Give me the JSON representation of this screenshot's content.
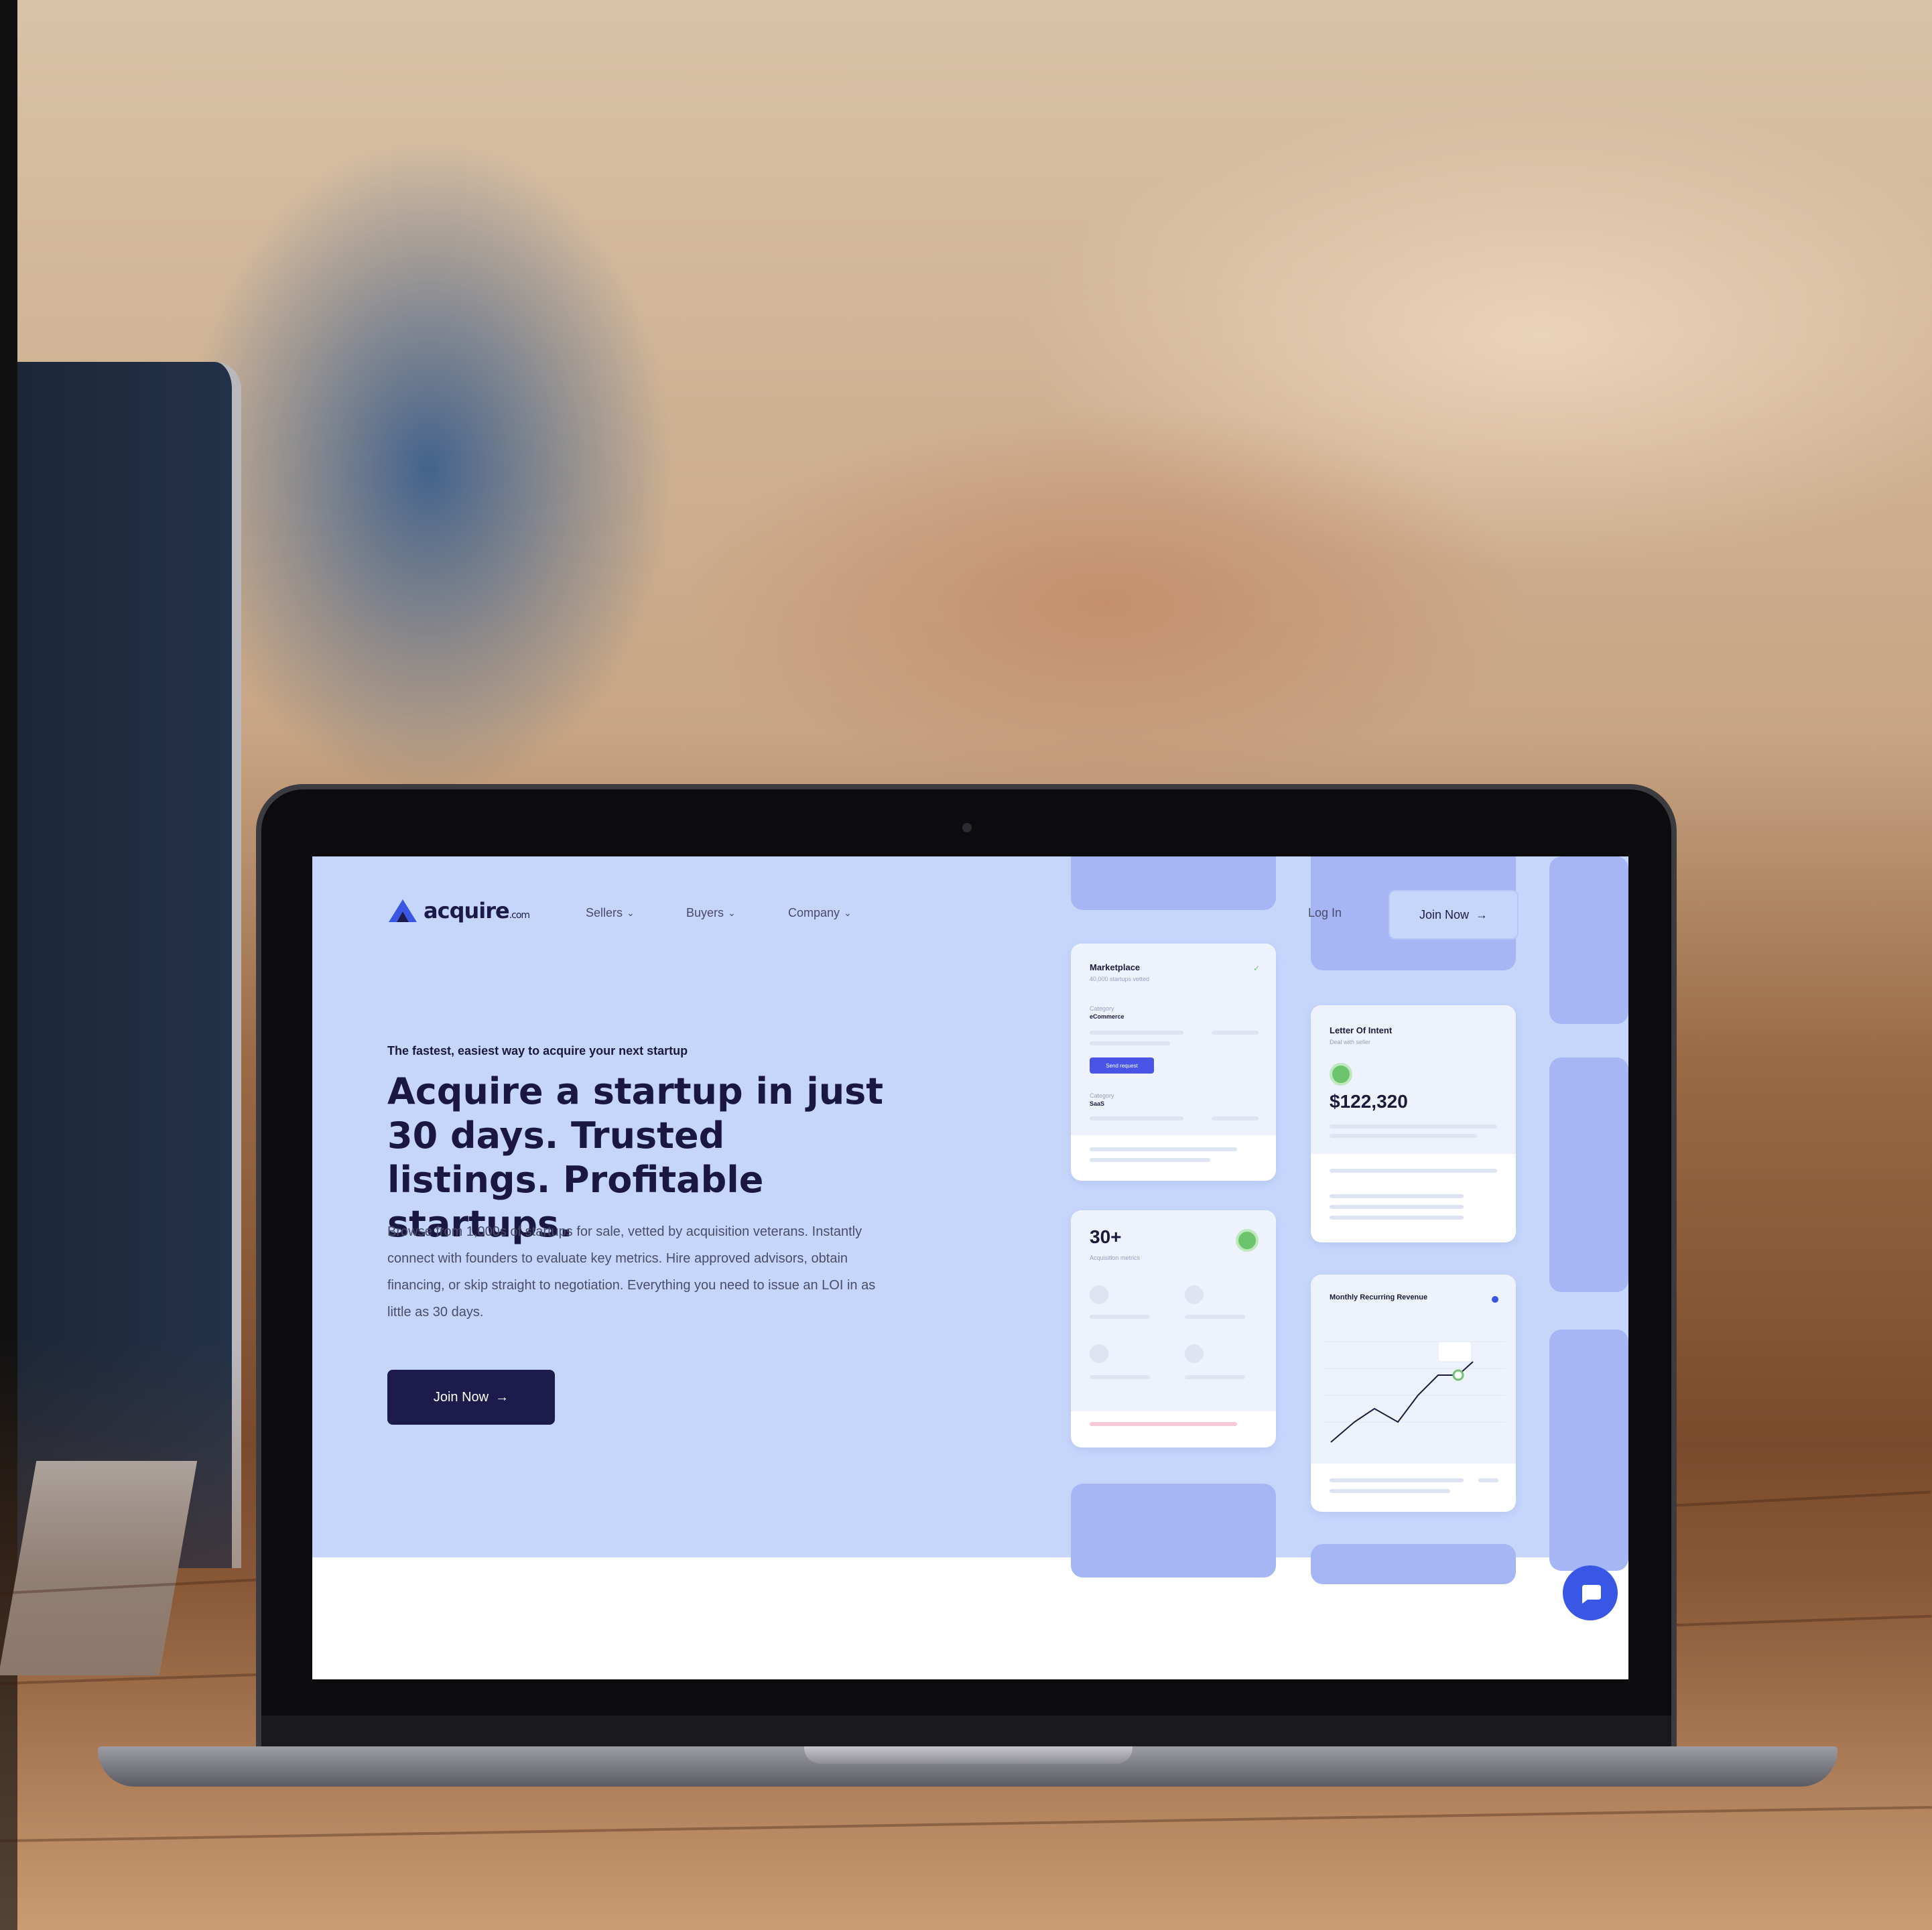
{
  "site": {
    "logo_text": "acquire",
    "logo_suffix": ".com",
    "nav": [
      {
        "label": "Sellers"
      },
      {
        "label": "Buyers"
      },
      {
        "label": "Company"
      }
    ],
    "login_label": "Log In",
    "join_nav_label": "Join Now"
  },
  "hero": {
    "tagline": "The fastest, easiest way to acquire your next startup",
    "headline": "Acquire a startup in just 30 days. Trusted listings. Profitable startups.",
    "description": "Browse from 1,000s of startups for sale, vetted by acquisition veterans. Instantly connect with founders to evaluate key metrics. Hire approved advisors, obtain financing, or skip straight to negotiation. Everything you need to issue an LOI in as little as 30 days.",
    "join_label": "Join Now"
  },
  "cards": {
    "marketplace_title": "Marketplace",
    "marketplace_subtitle": "40,000 startups vetted",
    "marketplace_field1_label": "Category",
    "marketplace_field1_value": "eCommerce",
    "marketplace_field2_label": "Category",
    "marketplace_field2_value": "SaaS",
    "marketplace_button": "Send request",
    "loi_title": "Letter Of Intent",
    "loi_subtitle": "Deal with seller",
    "loi_value": "$122,320",
    "stat_value": "30+",
    "stat_subtitle": "Acquisition metrics",
    "mrr_title": "Monthly Recurring Revenue"
  },
  "icons": {
    "logo": "acquire-logo-icon",
    "chevron": "chevron-down-icon",
    "arrow": "arrow-right-icon",
    "chat": "chat-bubble-icon",
    "check": "check-icon"
  },
  "colors": {
    "hero_bg": "#c6d6fb",
    "brand_dark": "#1d1b4b",
    "accent_blue": "#3a56e4",
    "card_block": "#a6b6f4",
    "success_green": "#6cc56c"
  }
}
